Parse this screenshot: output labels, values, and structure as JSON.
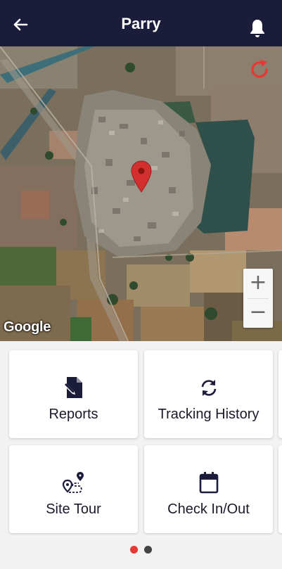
{
  "header": {
    "title": "Parry",
    "back_icon": "back-arrow-icon",
    "notification_icon": "bell-icon"
  },
  "map": {
    "attribution": "Google",
    "zoom_in": "+",
    "zoom_out": "−",
    "refresh_icon": "refresh-icon",
    "pin_icon": "map-pin-icon",
    "pin_color": "#d32f2f"
  },
  "menu": {
    "reports": {
      "label": "Reports",
      "icon": "report-edit-icon"
    },
    "tracking_history": {
      "label": "Tracking History",
      "icon": "sync-icon"
    },
    "site_tour": {
      "label": "Site Tour",
      "icon": "route-icon"
    },
    "check_in_out": {
      "label": "Check In/Out",
      "icon": "calendar-icon"
    }
  },
  "pager": {
    "active_color": "#e53935",
    "inactive_color": "#444444",
    "active_index": 0,
    "count": 2
  },
  "colors": {
    "app_bar": "#1b1b3a",
    "accent": "#e53935"
  }
}
